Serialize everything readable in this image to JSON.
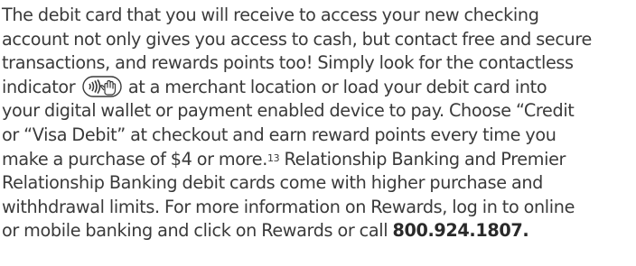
{
  "paragraph": {
    "l1": "The debit card that you will receive to access your new checking",
    "l2": "account not only gives you access to cash, but contact free and secure",
    "l3": "transactions, and rewards points too! Simply look for the contactless",
    "l4a": "indicator",
    "l4b": "at a merchant location or load your debit card into",
    "l5": "your digital wallet or payment enabled device to pay. Choose “Credit",
    "l6": "or “Visa Debit” at checkout and earn reward points every time you",
    "l7a": "make a purchase of $4 or more.",
    "l7_sup": "13",
    "l7b": " Relationship Banking and Premier",
    "l8": "Relationship Banking debit cards come with higher purchase and",
    "l9": "withhdrawal limits. For more information on Rewards, log in to online",
    "l10a": "or mobile banking and click on Rewards or call ",
    "phone": "800.924.1807."
  },
  "icons": {
    "contactless": "contactless-indicator-icon"
  },
  "colors": {
    "text": "#3a3a3a"
  }
}
